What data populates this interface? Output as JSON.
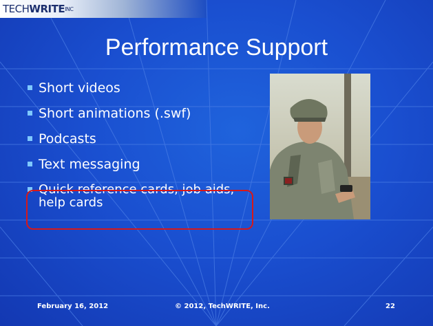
{
  "logo": {
    "prefix": "TECH",
    "bold": "WRITE",
    "suffix": "INC"
  },
  "title": "Performance Support",
  "bullets": [
    {
      "text": "Short videos"
    },
    {
      "text": "Short animations (.swf)"
    },
    {
      "text": "Podcasts"
    },
    {
      "text": "Text messaging"
    },
    {
      "text": "Quick reference cards, job aids, help cards"
    }
  ],
  "footer": {
    "date": "February 16, 2012",
    "copyright": "© 2012, TechWRITE, Inc.",
    "page": "22"
  },
  "colors": {
    "background": "#1a4fd0",
    "bullet": "#7ec8ff",
    "highlight": "#d81818",
    "text": "#ffffff"
  },
  "photo": {
    "subject": "soldier-using-mobile-phone"
  }
}
